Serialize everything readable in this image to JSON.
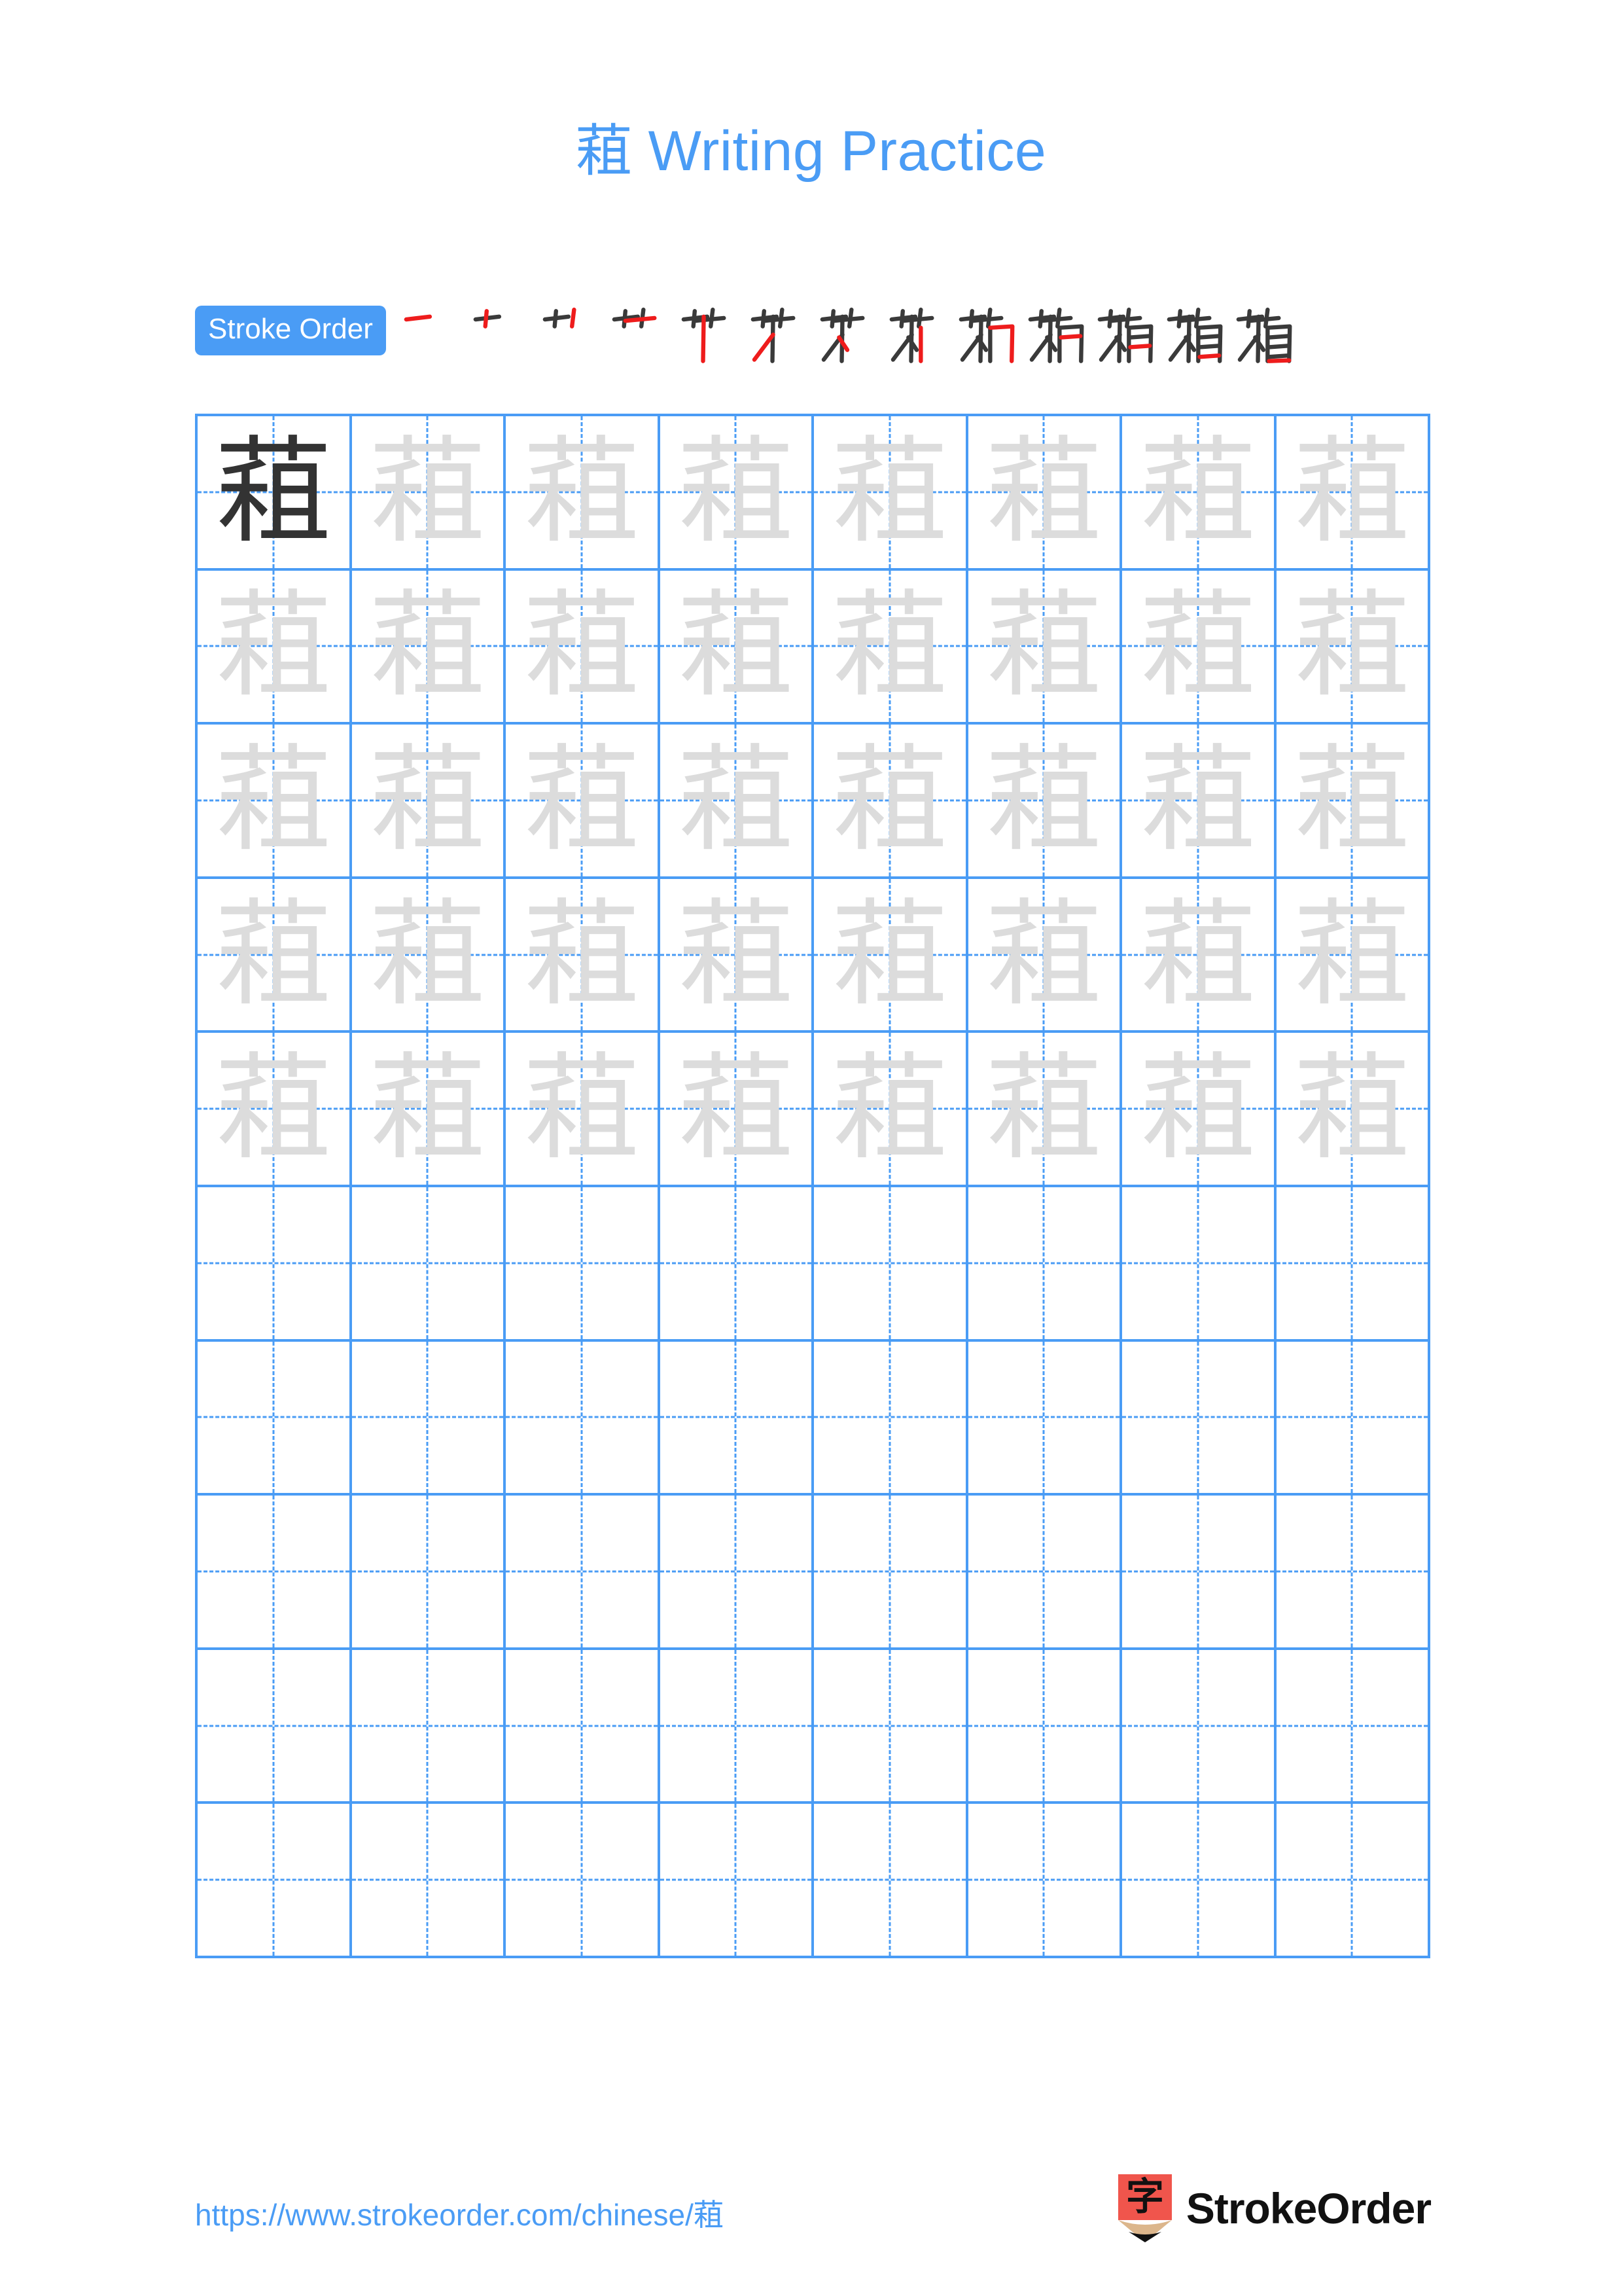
{
  "page": {
    "character": "蒩",
    "title_suffix": " Writing Practice",
    "title_full": "蒩 Writing Practice",
    "accent_color": "#4a9cf5",
    "trace_color": "#dcdcdc",
    "model_char_color": "#333333",
    "stroke_new_color": "#ee1c1c",
    "stroke_old_color": "#3a3a3a",
    "background_color": "#ffffff"
  },
  "stroke_order": {
    "badge_label": "Stroke Order",
    "total_strokes": 13,
    "steps": [
      {
        "index": 1,
        "glyph": "一"
      },
      {
        "index": 2,
        "glyph": "十"
      },
      {
        "index": 3,
        "glyph": "艹"
      },
      {
        "index": 4,
        "glyph": "䒑"
      },
      {
        "index": 5,
        "glyph": "艹"
      },
      {
        "index": 6,
        "glyph": "艻"
      },
      {
        "index": 7,
        "glyph": "莽"
      },
      {
        "index": 8,
        "glyph": "苴"
      },
      {
        "index": 9,
        "glyph": "莇"
      },
      {
        "index": 10,
        "glyph": "蒩"
      },
      {
        "index": 11,
        "glyph": "蒩"
      },
      {
        "index": 12,
        "glyph": "蒩"
      },
      {
        "index": 13,
        "glyph": "蒩"
      }
    ]
  },
  "grid": {
    "columns": 8,
    "rows": 10,
    "cells": [
      [
        "model",
        "trace",
        "trace",
        "trace",
        "trace",
        "trace",
        "trace",
        "trace"
      ],
      [
        "trace",
        "trace",
        "trace",
        "trace",
        "trace",
        "trace",
        "trace",
        "trace"
      ],
      [
        "trace",
        "trace",
        "trace",
        "trace",
        "trace",
        "trace",
        "trace",
        "trace"
      ],
      [
        "trace",
        "trace",
        "trace",
        "trace",
        "trace",
        "trace",
        "trace",
        "trace"
      ],
      [
        "trace",
        "trace",
        "trace",
        "trace",
        "trace",
        "trace",
        "trace",
        "trace"
      ],
      [
        "empty",
        "empty",
        "empty",
        "empty",
        "empty",
        "empty",
        "empty",
        "empty"
      ],
      [
        "empty",
        "empty",
        "empty",
        "empty",
        "empty",
        "empty",
        "empty",
        "empty"
      ],
      [
        "empty",
        "empty",
        "empty",
        "empty",
        "empty",
        "empty",
        "empty",
        "empty"
      ],
      [
        "empty",
        "empty",
        "empty",
        "empty",
        "empty",
        "empty",
        "empty",
        "empty"
      ],
      [
        "empty",
        "empty",
        "empty",
        "empty",
        "empty",
        "empty",
        "empty",
        "empty"
      ]
    ]
  },
  "footer": {
    "url_text": "https://www.strokeorder.com/chinese/蒩",
    "brand_name": "StrokeOrder",
    "logo_char": "字",
    "logo_body_color": "#f0554c",
    "logo_wood_color": "#dcb68c",
    "logo_tip_color": "#111111"
  }
}
